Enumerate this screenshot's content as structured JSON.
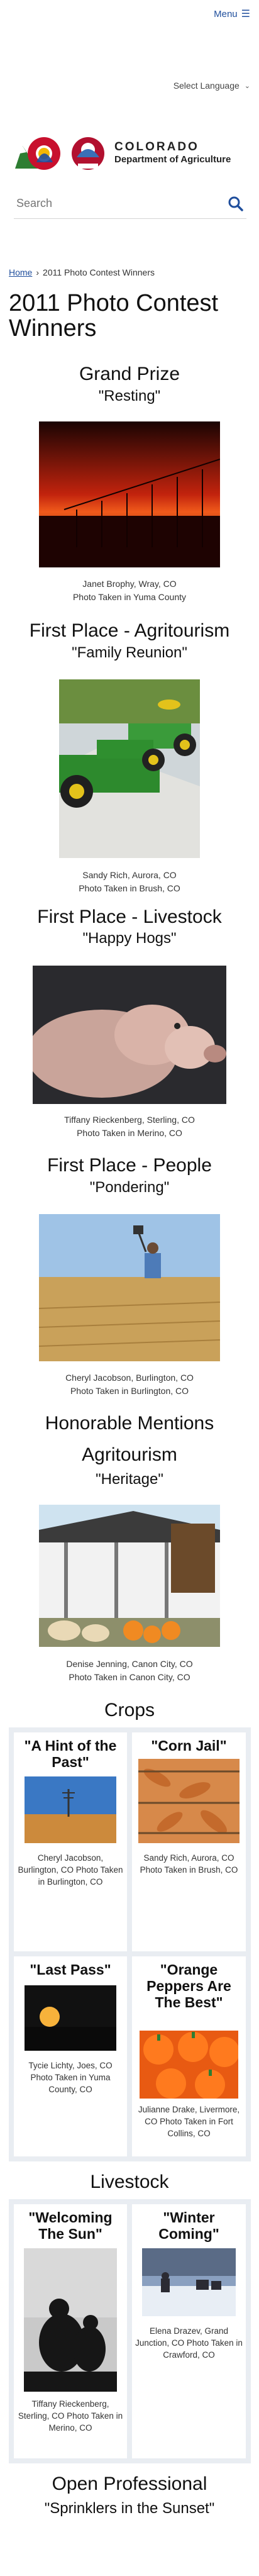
{
  "header": {
    "menu_label": "Menu",
    "language_label": "Select Language",
    "logo_line1": "COLORADO",
    "logo_line2": "Department of Agriculture",
    "logo_badge": "CDA",
    "search_placeholder": "Search"
  },
  "breadcrumb": {
    "home": "Home",
    "separator": "›",
    "current": "2011 Photo Contest Winners"
  },
  "page_title": "2011 Photo Contest Winners",
  "grand": {
    "heading": "Grand Prize",
    "title": "\"Resting\"",
    "cap1": "Janet Brophy, Wray, CO",
    "cap2": "Photo Taken in Yuma County"
  },
  "agritourism": {
    "heading": "First Place - Agritourism",
    "title": "\"Family Reunion\"",
    "cap1": "Sandy Rich, Aurora, CO",
    "cap2": "Photo Taken in Brush, CO"
  },
  "livestock": {
    "heading": "First Place - Livestock",
    "title": "\"Happy Hogs\"",
    "cap1": "Tiffany Rieckenberg, Sterling, CO",
    "cap2": "Photo Taken in Merino, CO"
  },
  "people": {
    "heading": "First Place - People",
    "title": "\"Pondering\"",
    "cap1": "Cheryl Jacobson, Burlington, CO",
    "cap2": "Photo Taken in Burlington, CO"
  },
  "honorable": {
    "heading": "Honorable Mentions",
    "agritourism_heading": "Agritourism",
    "agritourism_title": "\"Heritage\"",
    "agritourism_cap1": "Denise Jenning, Canon City, CO",
    "agritourism_cap2": "Photo Taken in Canon City, CO"
  },
  "crops": {
    "heading": "Crops",
    "items": [
      {
        "title": "\"A Hint of the Past\"",
        "caption": "Cheryl Jacobson, Burlington, CO Photo Taken in Burlington, CO"
      },
      {
        "title": "\"Corn Jail\"",
        "caption": "Sandy Rich, Aurora, CO Photo Taken in Brush, CO"
      },
      {
        "title": "\"Last Pass\"",
        "caption": "Tycie Lichty, Joes, CO Photo Taken in Yuma County, CO"
      },
      {
        "title": "\"Orange Peppers Are The Best\"",
        "caption": "Julianne Drake, Livermore, CO Photo Taken in Fort Collins, CO"
      }
    ]
  },
  "livestock_hm": {
    "heading": "Livestock",
    "items": [
      {
        "title": "\"Welcoming The Sun\"",
        "caption": "Tiffany Rieckenberg, Sterling, CO Photo Taken in Merino, CO"
      },
      {
        "title": "\"Winter Coming\"",
        "caption": "Elena Drazev, Grand Junction, CO Photo Taken in Crawford, CO"
      }
    ]
  },
  "open_professional": {
    "heading": "Open Professional",
    "title": "\"Sprinklers in the Sunset\""
  },
  "colors": {
    "link": "#1f4e9c",
    "grid_bg": "#e9edf2"
  }
}
